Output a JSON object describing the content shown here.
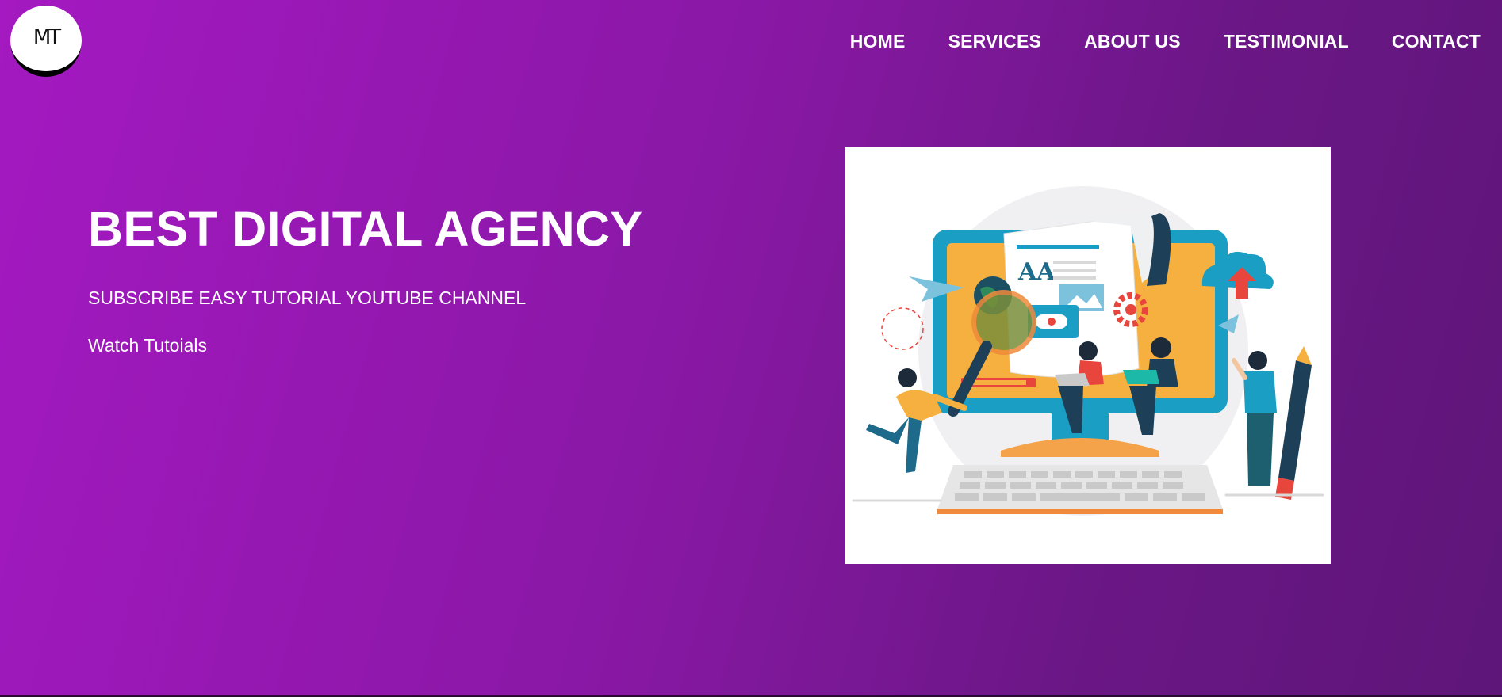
{
  "header": {
    "logo_text": "MT",
    "nav": [
      {
        "label": "HOME"
      },
      {
        "label": "SERVICES"
      },
      {
        "label": "ABOUT US"
      },
      {
        "label": "TESTIMONIAL"
      },
      {
        "label": "CONTACT"
      }
    ]
  },
  "hero": {
    "title": "BEST DIGITAL AGENCY",
    "subtitle": "SUBSCRIBE EASY TUTORIAL YOUTUBE CHANNEL",
    "cta_link": "Watch Tutoials",
    "illustration": {
      "icon": "digital-agency-illustration",
      "screen_heading": "AA"
    }
  },
  "colors": {
    "gradient_start": "#a419c1",
    "gradient_end": "#5e1679",
    "text": "#ffffff"
  }
}
